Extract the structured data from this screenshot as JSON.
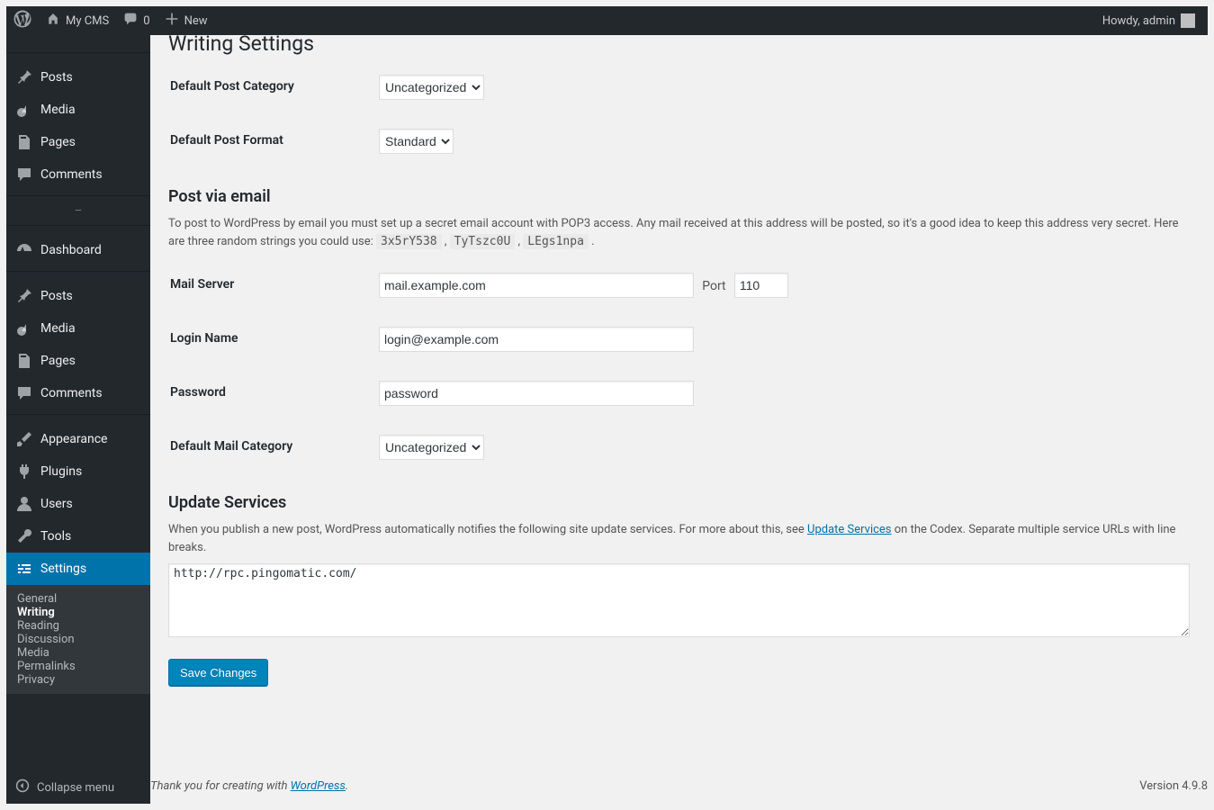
{
  "adminbar": {
    "site_name": "My CMS",
    "comments_count": "0",
    "new_label": "New",
    "howdy": "Howdy, admin"
  },
  "sidebar": {
    "truncated_first": "Dashboard",
    "group_a": [
      {
        "icon": "pin",
        "label": "Posts"
      },
      {
        "icon": "media",
        "label": "Media"
      },
      {
        "icon": "page",
        "label": "Pages"
      },
      {
        "icon": "comment",
        "label": "Comments"
      }
    ],
    "group_b": [
      {
        "icon": "gauge",
        "label": "Dashboard"
      },
      {
        "icon": "pin",
        "label": "Posts"
      },
      {
        "icon": "media",
        "label": "Media"
      },
      {
        "icon": "page",
        "label": "Pages"
      },
      {
        "icon": "comment",
        "label": "Comments"
      },
      {
        "icon": "brush",
        "label": "Appearance"
      },
      {
        "icon": "plug",
        "label": "Plugins"
      },
      {
        "icon": "user",
        "label": "Users"
      },
      {
        "icon": "wrench",
        "label": "Tools"
      },
      {
        "icon": "sliders",
        "label": "Settings"
      }
    ],
    "settings_sub": [
      "General",
      "Writing",
      "Reading",
      "Discussion",
      "Media",
      "Permalinks",
      "Privacy"
    ],
    "collapse": "Collapse menu"
  },
  "page": {
    "title": "Writing Settings",
    "default_category_label": "Default Post Category",
    "default_category_value": "Uncategorized",
    "default_format_label": "Default Post Format",
    "default_format_value": "Standard",
    "post_via_email_h": "Post via email",
    "post_via_email_desc_a": "To post to WordPress by email you must set up a secret email account with POP3 access. Any mail received at this address will be posted, so it's a good idea to keep this address very secret. Here are three random strings you could use: ",
    "rand1": "3x5rY538",
    "rand2": "TyTszc0U",
    "rand3": "LEgs1npa",
    "mail_server_label": "Mail Server",
    "mail_server_value": "mail.example.com",
    "port_label": "Port",
    "port_value": "110",
    "login_label": "Login Name",
    "login_value": "login@example.com",
    "password_label": "Password",
    "password_value": "password",
    "mail_category_label": "Default Mail Category",
    "mail_category_value": "Uncategorized",
    "update_services_h": "Update Services",
    "update_desc_a": "When you publish a new post, WordPress automatically notifies the following site update services. For more about this, see ",
    "update_link": "Update Services",
    "update_desc_b": " on the Codex. Separate multiple service URLs with line breaks.",
    "ping_textarea": "http://rpc.pingomatic.com/",
    "save": "Save Changes"
  },
  "footer": {
    "thank_a": "Thank you for creating with ",
    "wp": "WordPress",
    "version": "Version 4.9.8"
  }
}
